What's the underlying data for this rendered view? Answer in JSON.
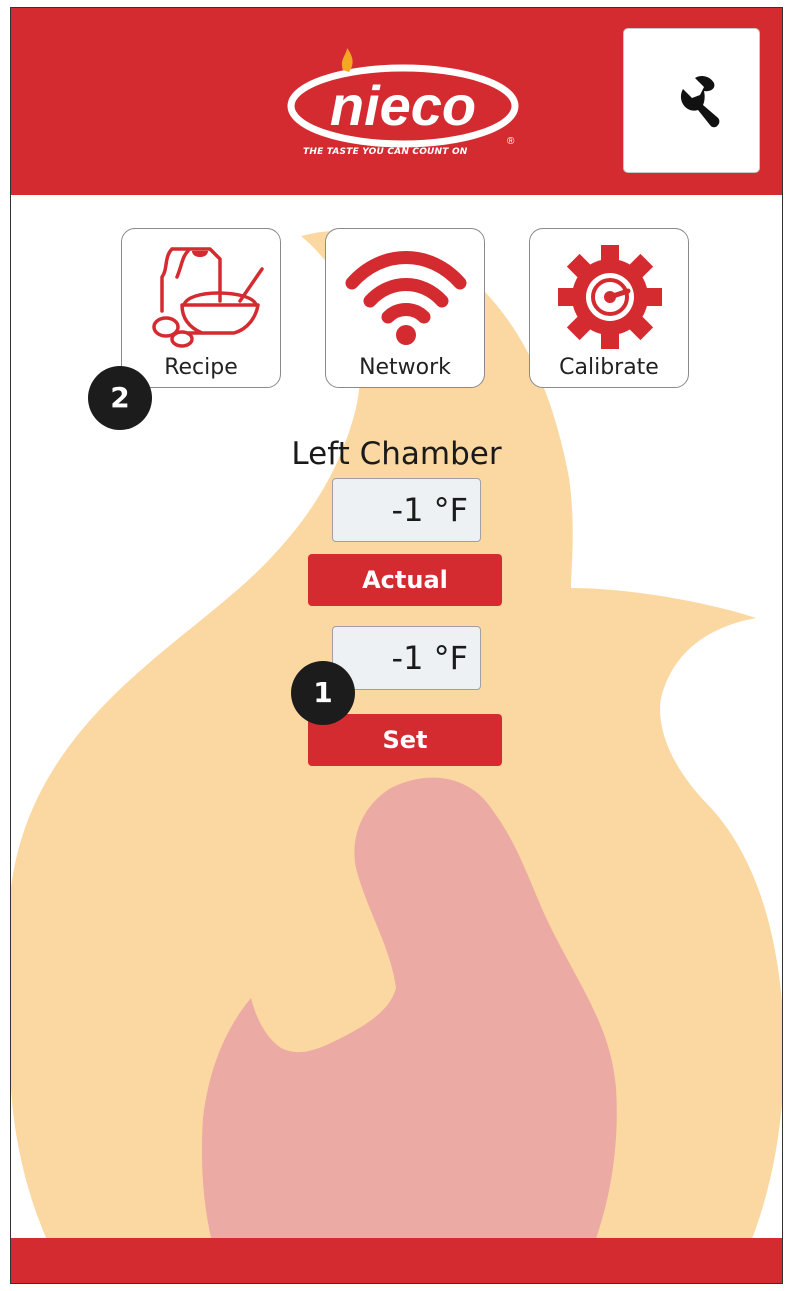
{
  "header": {
    "brand": "nieco",
    "tagline": "THE TASTE YOU CAN COUNT ON"
  },
  "tiles": [
    {
      "label": "Recipe",
      "icon": "recipe-icon"
    },
    {
      "label": "Network",
      "icon": "wifi-icon"
    },
    {
      "label": "Calibrate",
      "icon": "calibrate-gear-icon"
    }
  ],
  "chamber": {
    "title": "Left Chamber",
    "actual_temp": "-1 °F",
    "actual_label": "Actual",
    "set_temp": "-1 °F",
    "set_label": "Set"
  },
  "callouts": {
    "one": "1",
    "two": "2"
  },
  "colors": {
    "brand_red": "#d42b31",
    "flame_outer": "#fbd7a1",
    "flame_inner": "#ebaaa4",
    "badge": "#1c1c1c"
  }
}
